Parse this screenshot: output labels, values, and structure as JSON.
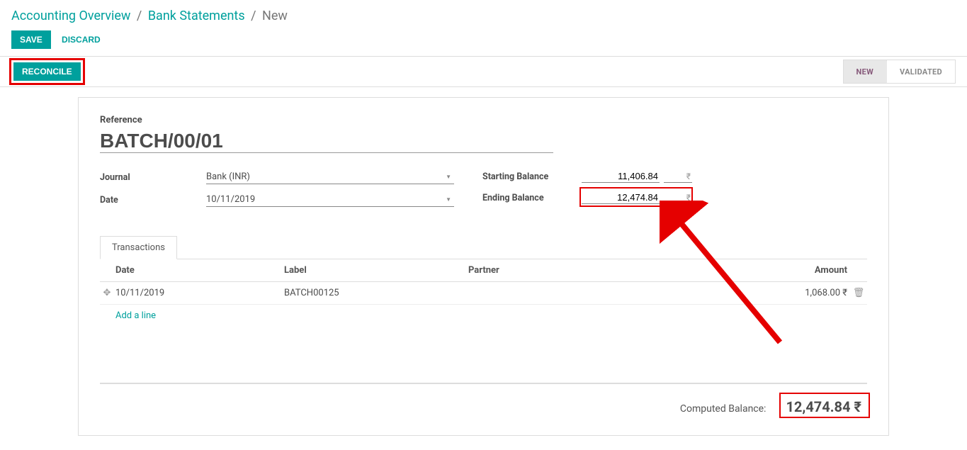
{
  "breadcrumbs": {
    "root": "Accounting Overview",
    "mid": "Bank Statements",
    "current": "New"
  },
  "actions": {
    "save": "SAVE",
    "discard": "DISCARD",
    "reconcile": "RECONCILE"
  },
  "status": {
    "new": "NEW",
    "validated": "VALIDATED"
  },
  "form": {
    "reference_label": "Reference",
    "reference": "BATCH/00/01",
    "journal_label": "Journal",
    "journal": "Bank (INR)",
    "date_label": "Date",
    "date": "10/11/2019",
    "starting_label": "Starting Balance",
    "starting_value": "11,406.84",
    "ending_label": "Ending Balance",
    "ending_value": "12,474.84",
    "currency": "₹"
  },
  "tabs": {
    "transactions": "Transactions"
  },
  "grid": {
    "headers": {
      "date": "Date",
      "label": "Label",
      "partner": "Partner",
      "amount": "Amount"
    },
    "rows": [
      {
        "date": "10/11/2019",
        "label": "BATCH00125",
        "partner": "",
        "amount": "1,068.00 ₹"
      }
    ],
    "add_line": "Add a line"
  },
  "computed": {
    "label": "Computed Balance:",
    "value": "12,474.84 ₹"
  }
}
